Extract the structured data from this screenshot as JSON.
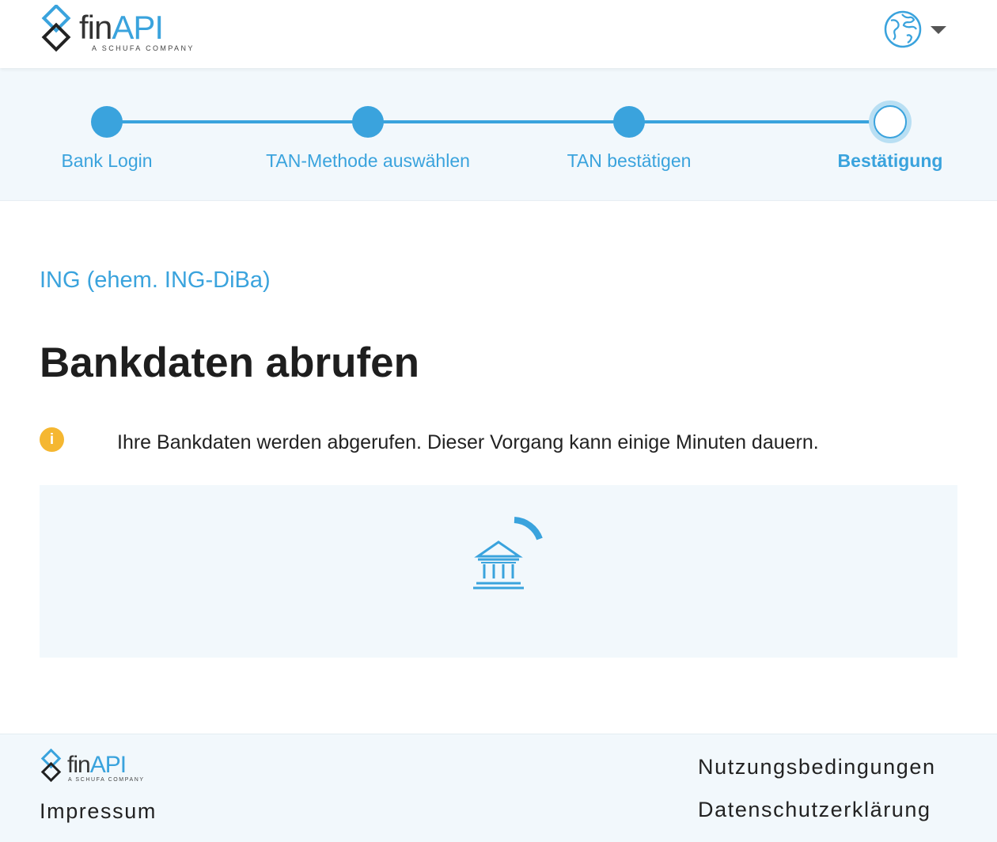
{
  "header": {
    "logo": {
      "brand_part1": "fin",
      "brand_part2": "API",
      "tagline": "A SCHUFA COMPANY"
    },
    "language_icon": "globe-icon"
  },
  "stepper": {
    "steps": [
      {
        "label": "Bank Login",
        "state": "done"
      },
      {
        "label": "TAN-Methode auswählen",
        "state": "done"
      },
      {
        "label": "TAN bestätigen",
        "state": "done"
      },
      {
        "label": "Bestätigung",
        "state": "current"
      }
    ]
  },
  "main": {
    "bank_name": "ING (ehem. ING-DiBa)",
    "title": "Bankdaten abrufen",
    "info_icon_glyph": "i",
    "info_text": "Ihre Bankdaten werden abgerufen. Dieser Vorgang kann einige Minuten dauern.",
    "loader_icon": "bank-icon"
  },
  "footer": {
    "logo": {
      "brand_part1": "fin",
      "brand_part2": "API",
      "tagline": "A SCHUFA COMPANY"
    },
    "links": {
      "impressum": "Impressum",
      "terms": "Nutzungsbedingungen",
      "privacy": "Datenschutzerklärung"
    }
  },
  "colors": {
    "accent": "#3aa3dd",
    "light_background": "#f2f8fc",
    "info": "#f5b731",
    "text": "#222222"
  }
}
